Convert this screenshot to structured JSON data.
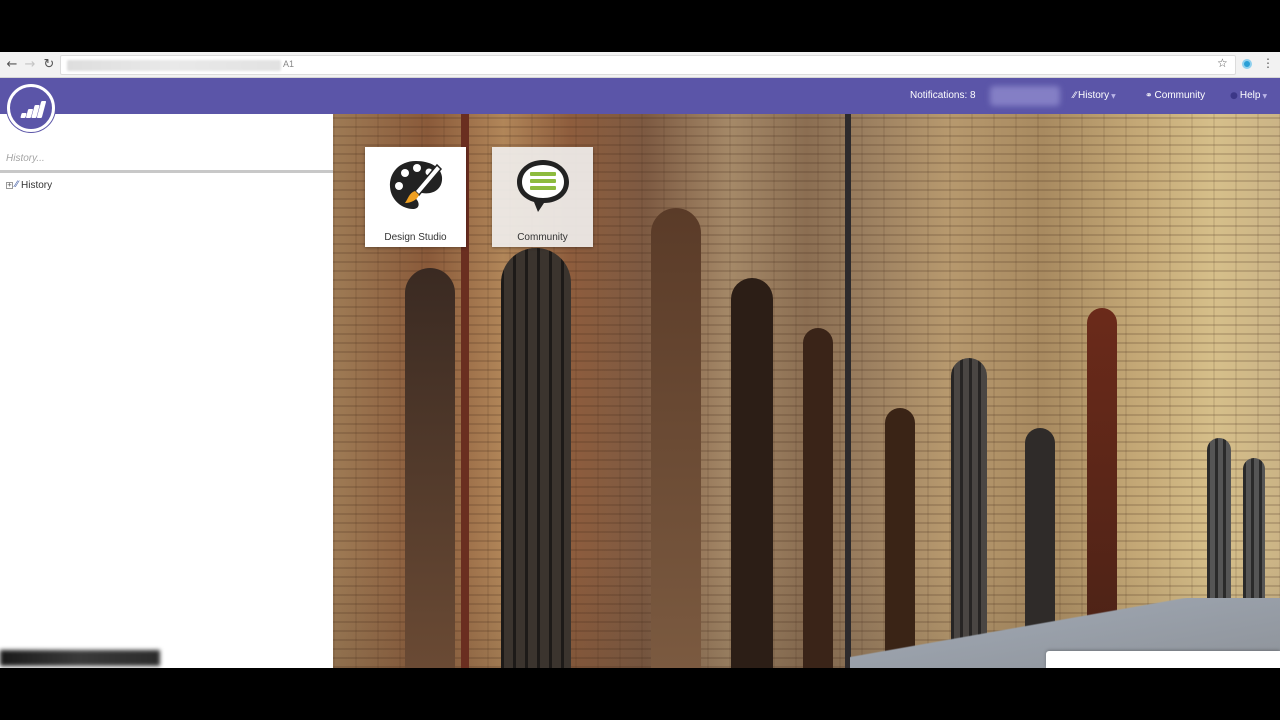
{
  "browser": {
    "address_suffix": "A1"
  },
  "header": {
    "notifications_label": "Notifications: 8",
    "menu": [
      {
        "label": "History"
      },
      {
        "label": "Community"
      },
      {
        "label": "Help"
      }
    ],
    "brand_color": "#5b55a8"
  },
  "sidebar": {
    "search_placeholder": "History...",
    "tree": [
      {
        "label": "History",
        "icon": "history-icon"
      }
    ]
  },
  "tiles": [
    {
      "label": "Design Studio",
      "icon": "palette-icon"
    },
    {
      "label": "Community",
      "icon": "speech-bubble-icon"
    }
  ]
}
